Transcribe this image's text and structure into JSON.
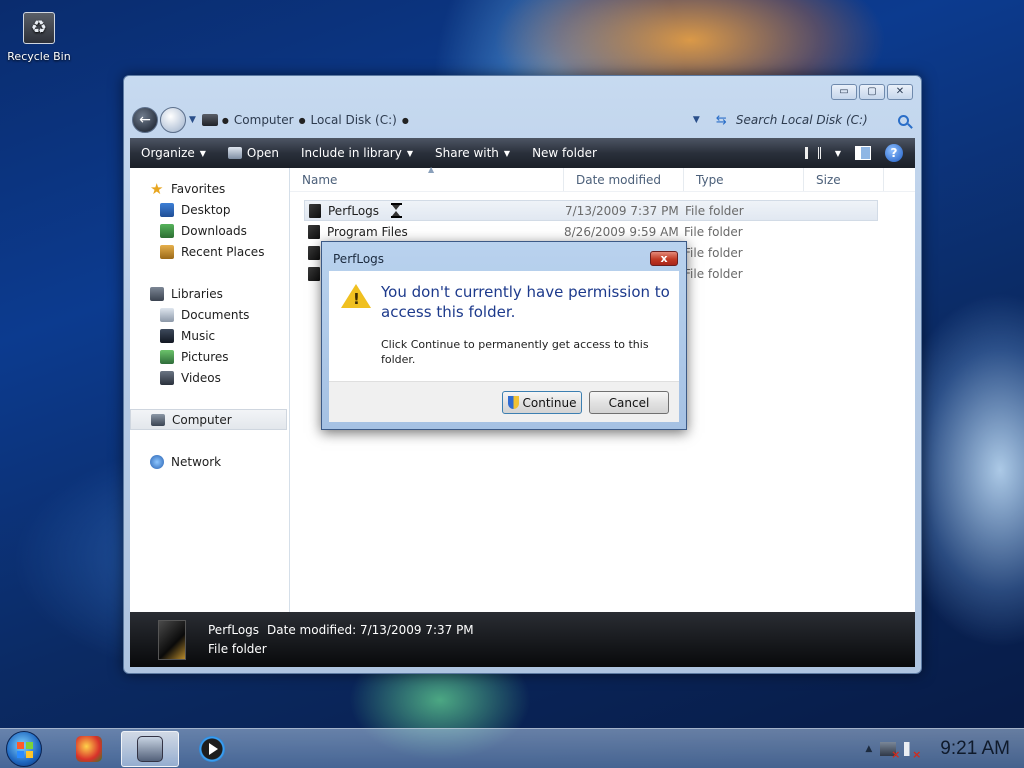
{
  "desktop": {
    "recycle_bin_label": "Recycle Bin"
  },
  "window": {
    "controls": {
      "minimize": "▭",
      "maximize": "▢",
      "close": "✕"
    },
    "breadcrumbs": [
      "Computer",
      "Local Disk (C:)"
    ],
    "search_placeholder": "Search Local Disk (C:)",
    "toolbar": {
      "organize": "Organize",
      "open": "Open",
      "include_in_library": "Include in library",
      "share_with": "Share with",
      "new_folder": "New folder",
      "help": "?"
    },
    "nav": {
      "favorites": "Favorites",
      "desktop": "Desktop",
      "downloads": "Downloads",
      "recent_places": "Recent Places",
      "libraries": "Libraries",
      "documents": "Documents",
      "music": "Music",
      "pictures": "Pictures",
      "videos": "Videos",
      "computer": "Computer",
      "network": "Network"
    },
    "columns": {
      "name": "Name",
      "date_modified": "Date modified",
      "type": "Type",
      "size": "Size"
    },
    "rows": [
      {
        "name": "PerfLogs",
        "date": "7/13/2009 7:37 PM",
        "type": "File folder"
      },
      {
        "name": "Program Files",
        "date": "8/26/2009 9:59 AM",
        "type": "File folder"
      },
      {
        "name": "",
        "date": "",
        "type": "File folder"
      },
      {
        "name": "",
        "date": "",
        "type": "File folder"
      }
    ],
    "details": {
      "name": "PerfLogs",
      "date_label": "Date modified:",
      "date_value": "7/13/2009 7:37 PM",
      "type": "File folder"
    }
  },
  "dialog": {
    "title": "PerfLogs",
    "close": "x",
    "main_text": "You don't currently have permission to access this folder.",
    "sub_text": "Click Continue to permanently get access to this folder.",
    "continue_label": "Continue",
    "cancel_label": "Cancel"
  },
  "taskbar": {
    "clock": "9:21 AM",
    "tray_expand": "▲"
  }
}
